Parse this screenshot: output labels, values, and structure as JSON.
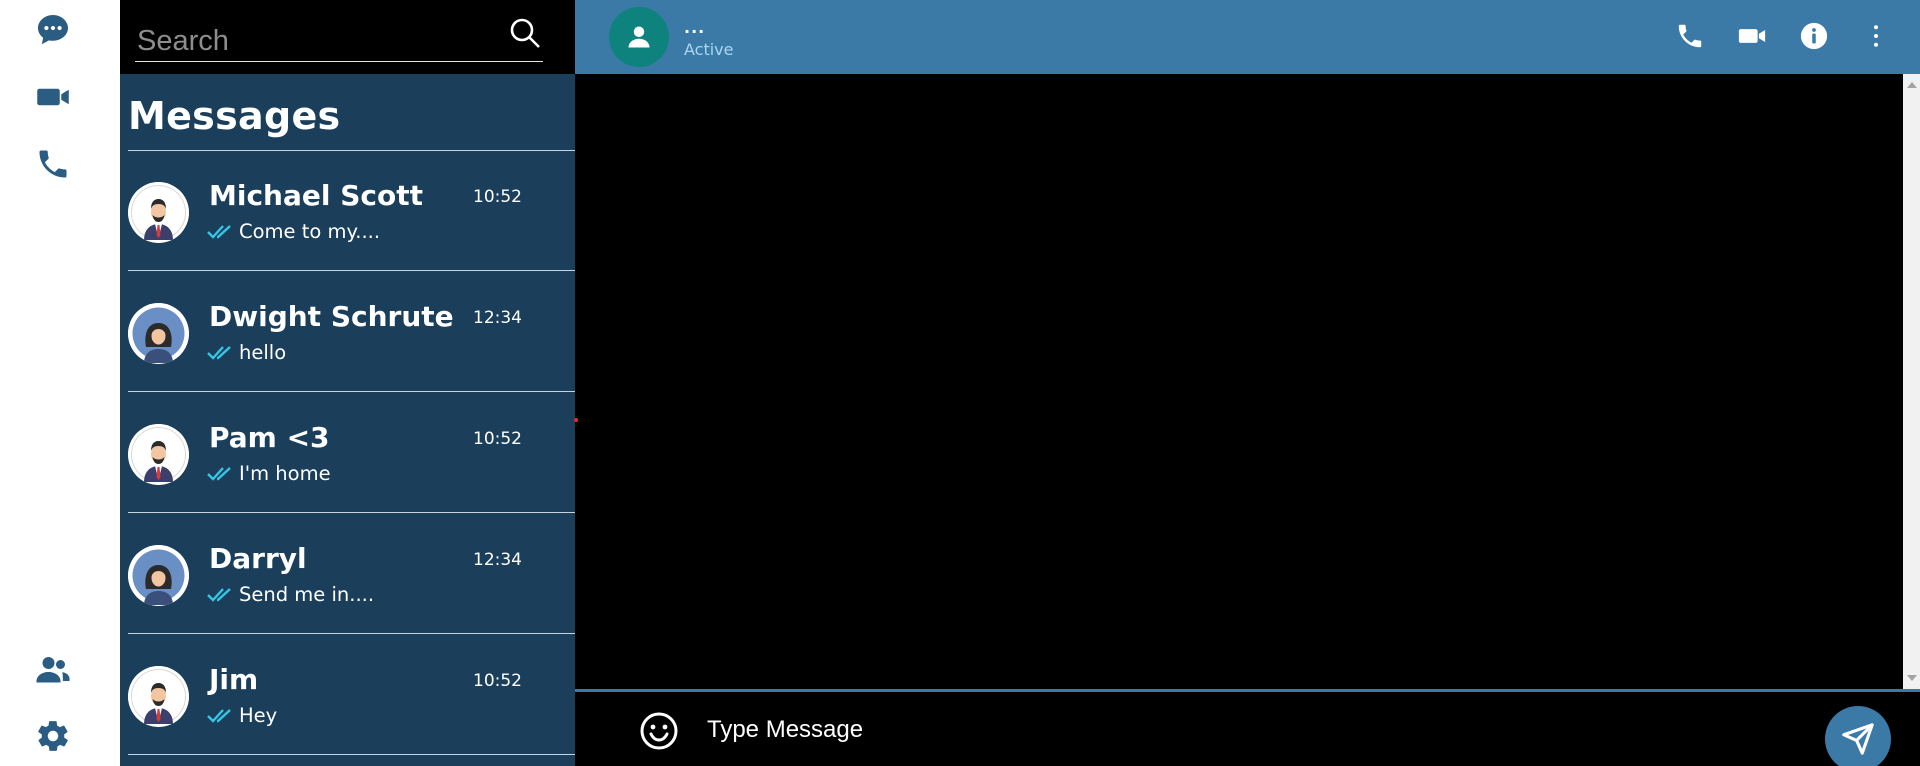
{
  "rail": {
    "items": [
      {
        "icon": "chat-bubble-icon"
      },
      {
        "icon": "video-camera-icon"
      },
      {
        "icon": "phone-icon"
      },
      {
        "icon": "contacts-icon"
      },
      {
        "icon": "settings-gear-icon"
      }
    ],
    "icon_color": "#2b5d83"
  },
  "search": {
    "placeholder": "Search",
    "value": ""
  },
  "panel": {
    "title": "Messages",
    "background": "#1b3f5b"
  },
  "conversations": [
    {
      "name": "Michael Scott",
      "time": "10:52",
      "preview": "Come to my....",
      "avatar": "man-avatar",
      "status_icon": "double-check-icon"
    },
    {
      "name": "Dwight Schrute",
      "time": "12:34",
      "preview": "hello",
      "avatar": "woman-avatar",
      "status_icon": "double-check-icon"
    },
    {
      "name": "Pam <3",
      "time": "10:52",
      "preview": "I'm home",
      "avatar": "man-avatar",
      "status_icon": "double-check-icon"
    },
    {
      "name": "Darryl",
      "time": "12:34",
      "preview": "Send me in....",
      "avatar": "woman-avatar",
      "status_icon": "double-check-icon"
    },
    {
      "name": "Jim",
      "time": "10:52",
      "preview": "Hey",
      "avatar": "man-avatar",
      "status_icon": "double-check-icon"
    }
  ],
  "chat": {
    "contact_name": "...",
    "contact_status": "Active",
    "header_color": "#3b79a7",
    "actions": [
      {
        "icon": "phone-icon"
      },
      {
        "icon": "video-camera-icon"
      },
      {
        "icon": "info-icon"
      },
      {
        "icon": "more-vertical-icon"
      }
    ]
  },
  "composer": {
    "placeholder": "Type Message",
    "value": ""
  }
}
